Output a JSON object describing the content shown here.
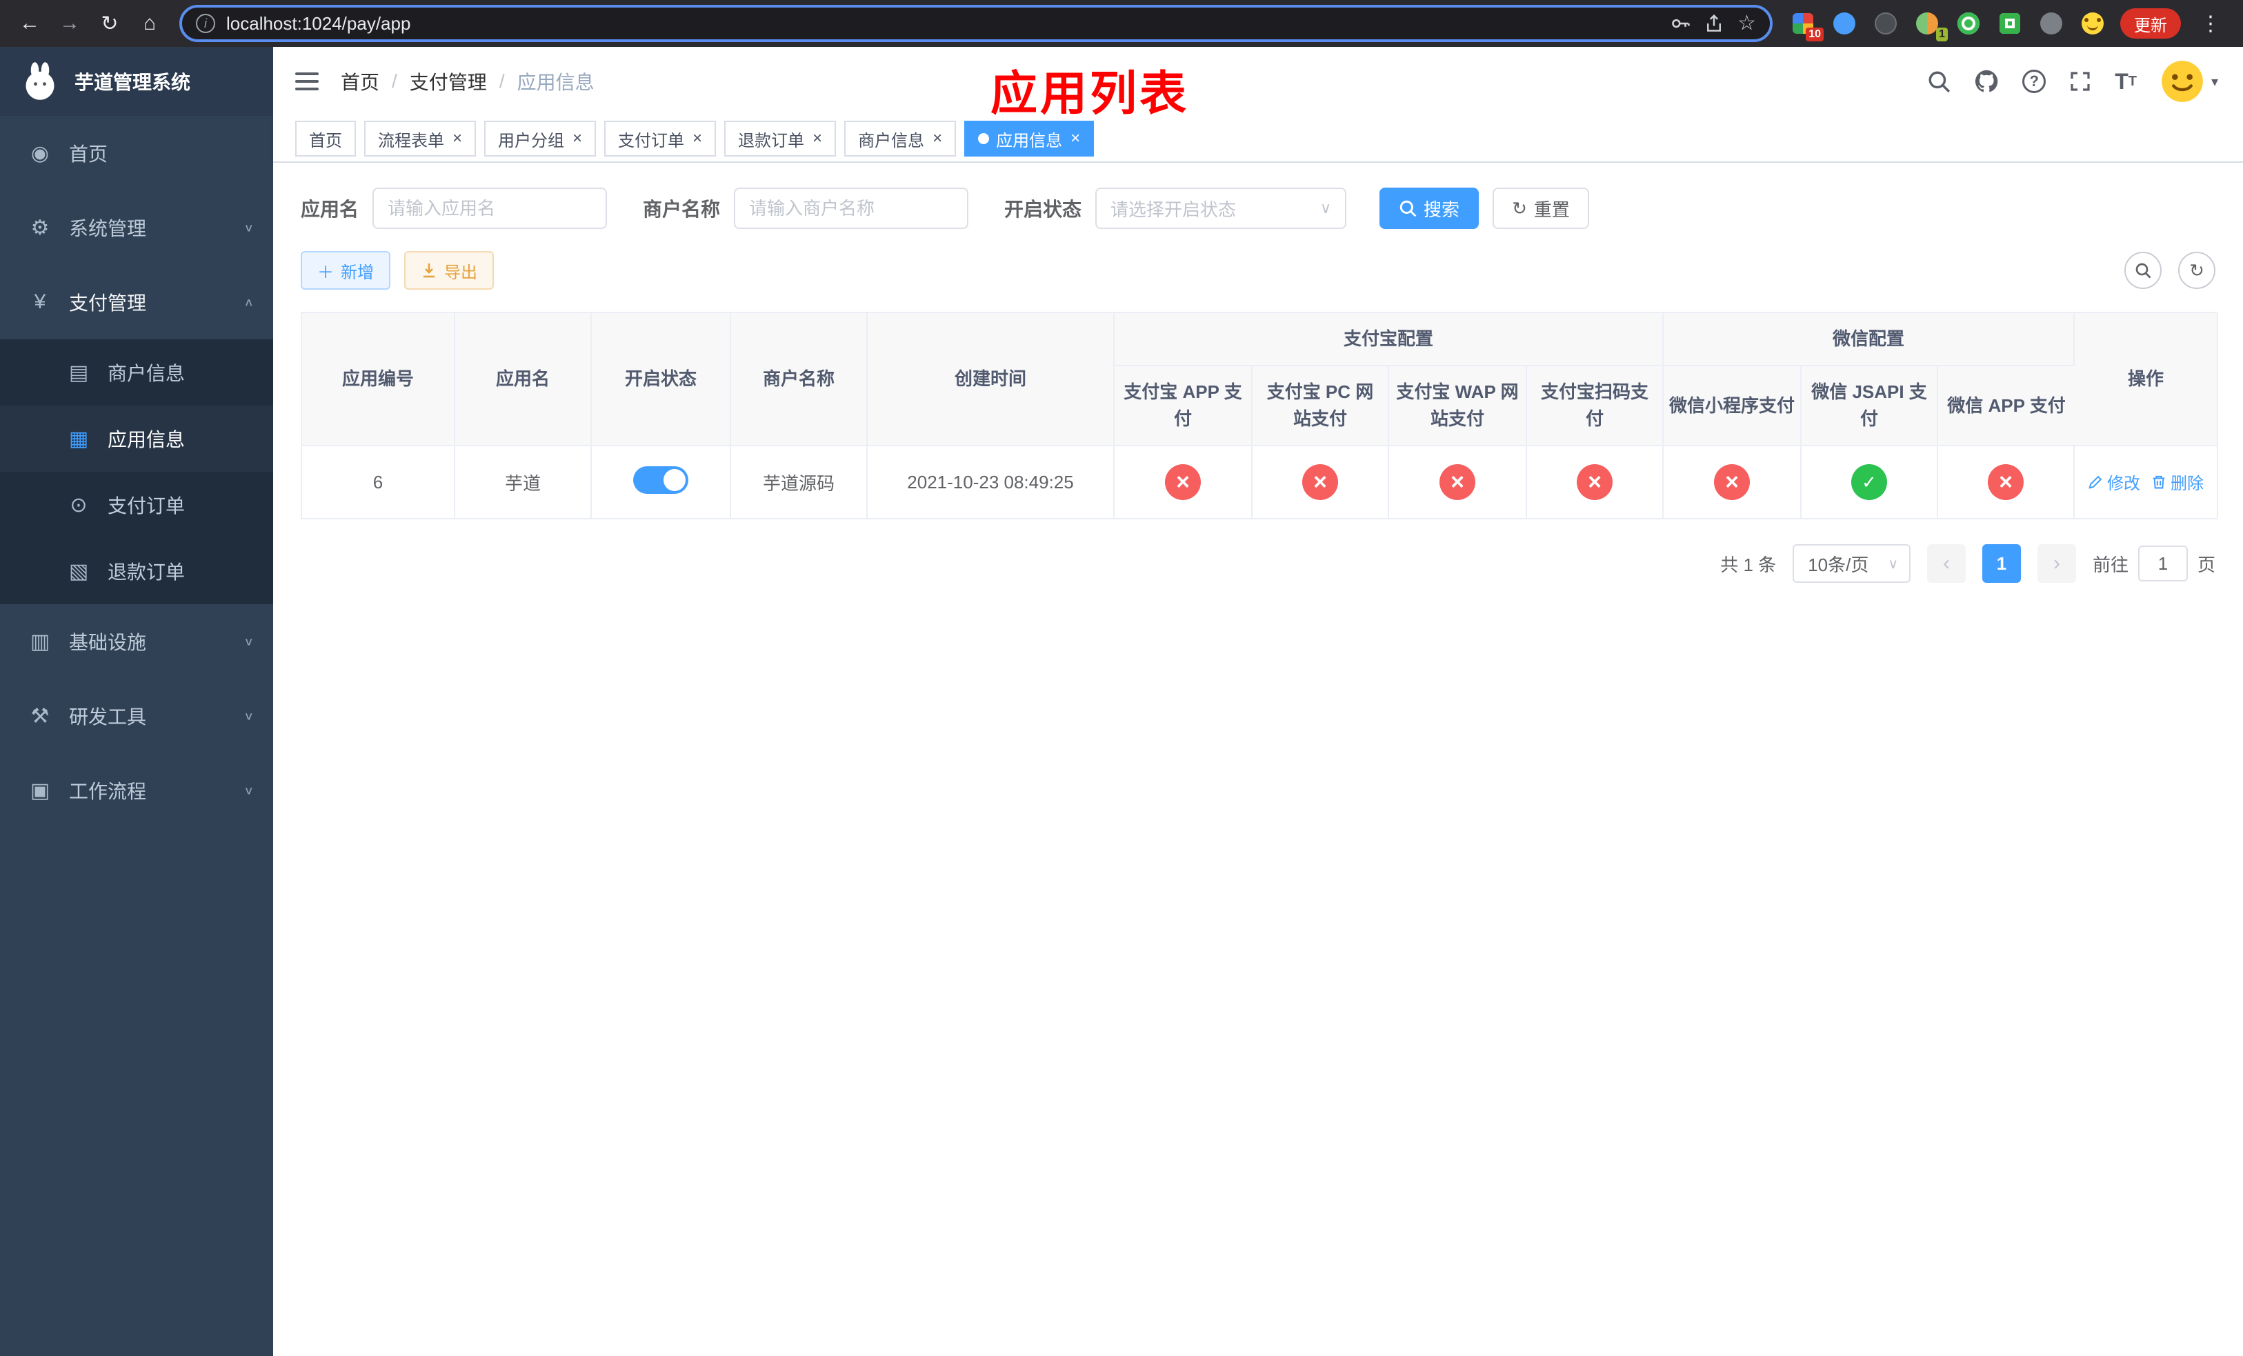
{
  "colors": {
    "primary": "#409eff",
    "danger": "#f75e5e",
    "success": "#2bc250",
    "annotation": "#fe0000",
    "sidebar_bg": "#304156",
    "submenu_bg": "#1f2d3d"
  },
  "browser": {
    "url": "localhost:1024/pay/app",
    "update_label": "更新",
    "badge_grid": "10",
    "badge_avatar": "1"
  },
  "sidebar": {
    "logo_title": "芋道管理系统",
    "items": {
      "home": "首页",
      "system": "系统管理",
      "payment": "支付管理",
      "merchant": "商户信息",
      "app": "应用信息",
      "pay_order": "支付订单",
      "refund_order": "退款订单",
      "infra": "基础设施",
      "devtools": "研发工具",
      "workflow": "工作流程"
    }
  },
  "navbar": {
    "breadcrumb": {
      "home": "首页",
      "section": "支付管理",
      "page": "应用信息"
    },
    "annotation": "应用列表"
  },
  "tabs": [
    "首页",
    "流程表单",
    "用户分组",
    "支付订单",
    "退款订单",
    "商户信息",
    "应用信息"
  ],
  "filters": {
    "app_name_label": "应用名",
    "app_name_placeholder": "请输入应用名",
    "merchant_label": "商户名称",
    "merchant_placeholder": "请输入商户名称",
    "status_label": "开启状态",
    "status_placeholder": "请选择开启状态",
    "search_label": "搜索",
    "reset_label": "重置"
  },
  "toolbar": {
    "add_label": "新增",
    "export_label": "导出"
  },
  "table": {
    "groups": {
      "alipay": "支付宝配置",
      "wechat": "微信配置"
    },
    "columns": [
      "应用编号",
      "应用名",
      "开启状态",
      "商户名称",
      "创建时间",
      "支付宝 APP 支付",
      "支付宝 PC 网站支付",
      "支付宝 WAP 网站支付",
      "支付宝扫码支付",
      "微信小程序支付",
      "微信 JSAPI 支付",
      "微信 APP 支付",
      "操作"
    ],
    "rows": [
      {
        "id": "6",
        "name": "芋道",
        "enabled": true,
        "merchant": "芋道源码",
        "created": "2021-10-23 08:49:25",
        "status": {
          "alipay_app": false,
          "alipay_pc": false,
          "alipay_wap": false,
          "alipay_qr": false,
          "wx_lite": false,
          "wx_jsapi": true,
          "wx_app": false
        },
        "actions": {
          "edit": "修改",
          "delete": "删除"
        }
      }
    ]
  },
  "pagination": {
    "total": "共 1 条",
    "page_size": "10条/页",
    "page": "1",
    "goto_prefix": "前往",
    "goto_value": "1",
    "goto_suffix": "页"
  }
}
